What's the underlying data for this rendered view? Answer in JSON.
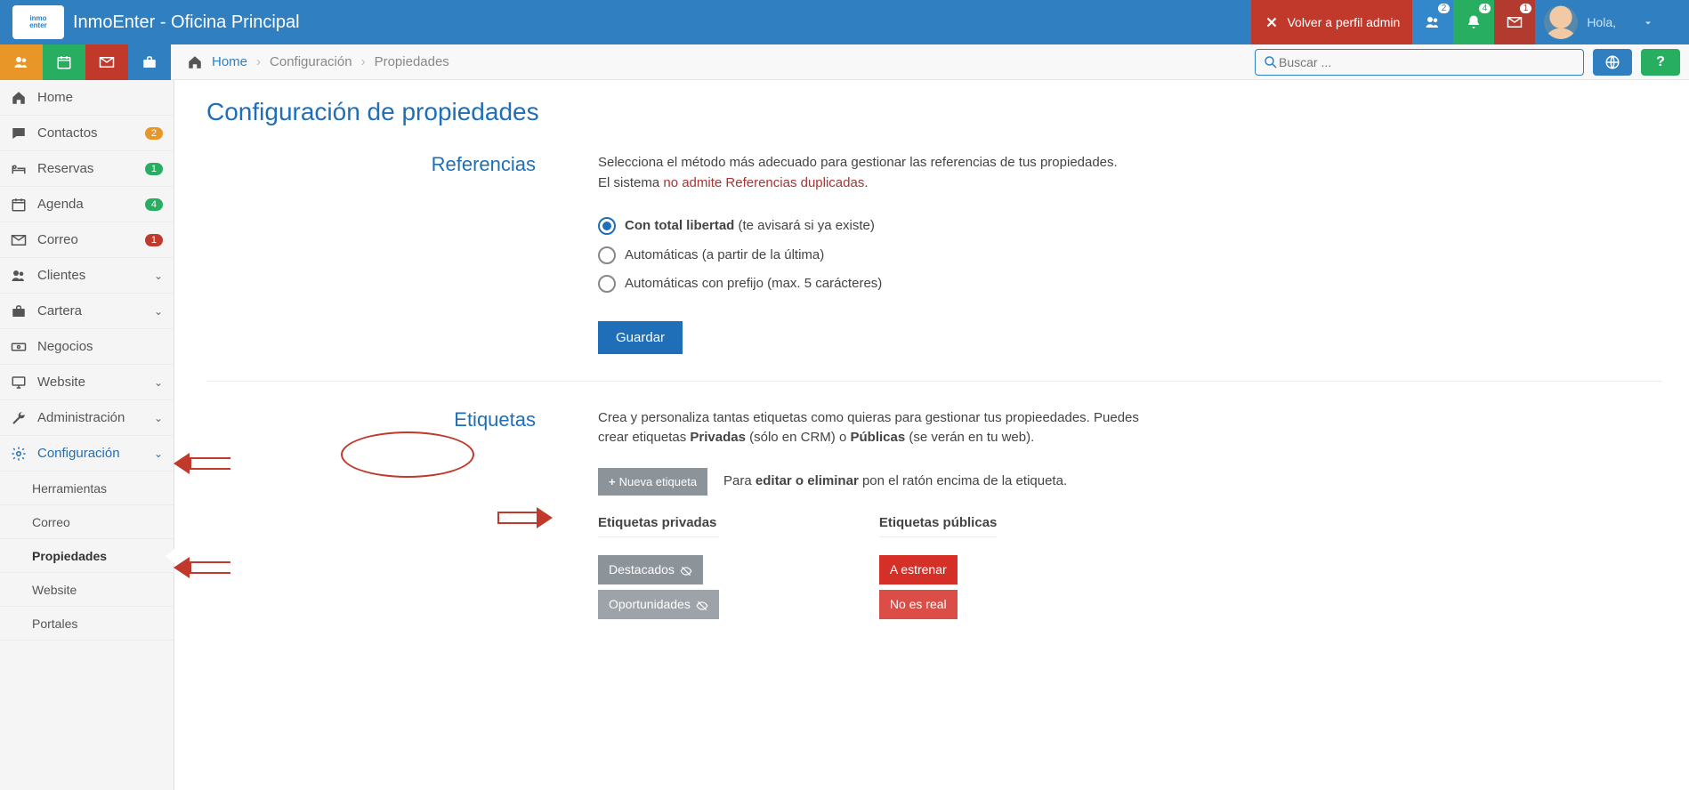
{
  "header": {
    "app_title": "InmoEnter - Oficina Principal",
    "return_admin": "Volver a perfil admin",
    "greeting": "Hola,",
    "badges": {
      "users": "2",
      "bell": "4",
      "mail": "1"
    }
  },
  "toolbar": {
    "home_link": "Home",
    "crumb1": "Configuración",
    "crumb2": "Propiedades",
    "search_placeholder": "Buscar ..."
  },
  "sidebar": {
    "items": [
      {
        "label": "Home"
      },
      {
        "label": "Contactos",
        "badge": "2",
        "badge_color": "orange"
      },
      {
        "label": "Reservas",
        "badge": "1",
        "badge_color": "green"
      },
      {
        "label": "Agenda",
        "badge": "4",
        "badge_color": "green"
      },
      {
        "label": "Correo",
        "badge": "1",
        "badge_color": "red"
      },
      {
        "label": "Clientes",
        "chev": true
      },
      {
        "label": "Cartera",
        "chev": true
      },
      {
        "label": "Negocios"
      },
      {
        "label": "Website",
        "chev": true
      },
      {
        "label": "Administración",
        "chev": true
      },
      {
        "label": "Configuración",
        "chev": true,
        "active": true
      }
    ],
    "subitems": [
      {
        "label": "Herramientas"
      },
      {
        "label": "Correo"
      },
      {
        "label": "Propiedades",
        "active": true
      },
      {
        "label": "Website"
      },
      {
        "label": "Portales"
      }
    ]
  },
  "page": {
    "title": "Configuración de propiedades",
    "section_ref": {
      "label": "Referencias",
      "desc1": "Selecciona el método más adecuado para gestionar las referencias de tus propiedades.",
      "desc2a": "El sistema ",
      "desc2b": "no admite Referencias duplicadas",
      "desc2c": ".",
      "opt1_bold": "Con total libertad",
      "opt1_rest": " (te avisará si ya existe)",
      "opt2": "Automáticas (a partir de la última)",
      "opt3": "Automáticas con prefijo (max. 5 carácteres)",
      "save": "Guardar"
    },
    "section_tags": {
      "label": "Etiquetas",
      "desc1a": "Crea y personaliza tantas etiquetas como quieras para gestionar tus propieedades. Puedes crear etiquetas ",
      "desc1b": "Privadas",
      "desc1c": " (sólo en CRM) o ",
      "desc1d": "Públicas",
      "desc1e": " (se verán en tu web).",
      "new_tag": "Nueva etiqueta",
      "help1a": "Para ",
      "help1b": "editar o eliminar",
      "help1c": " pon el ratón encima de la etiqueta.",
      "col_private": "Etiquetas privadas",
      "col_public": "Etiquetas públicas",
      "priv_tags": [
        "Destacados",
        "Oportunidades"
      ],
      "pub_tags": [
        "A estrenar",
        "No es real"
      ]
    }
  }
}
